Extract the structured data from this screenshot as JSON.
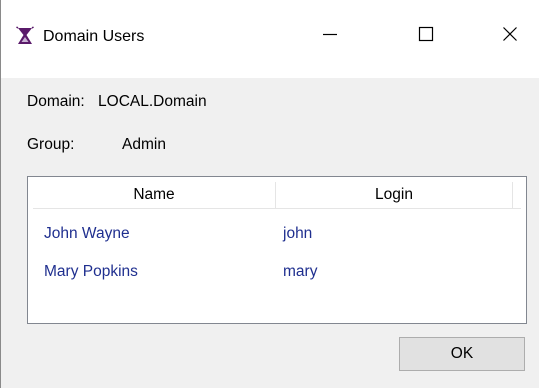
{
  "window": {
    "title": "Domain Users",
    "icon": "hourglass-icon",
    "controls": {
      "minimize": "minimize-icon",
      "maximize": "maximize-icon",
      "close": "close-icon"
    }
  },
  "fields": {
    "domain": {
      "label": "Domain:",
      "value": "LOCAL.Domain"
    },
    "group": {
      "label": "Group:",
      "value": "Admin"
    }
  },
  "users_table": {
    "columns": [
      "Name",
      "Login"
    ],
    "rows": [
      {
        "name": "John Wayne",
        "login": "john"
      },
      {
        "name": "Mary Popkins",
        "login": "mary"
      }
    ],
    "row_text_color": "#1f2f8f"
  },
  "buttons": {
    "ok": "OK"
  },
  "colors": {
    "icon_accent": "#5a1a6a",
    "window_bg": "#f0f0f0",
    "titlebar_bg": "#ffffff"
  }
}
